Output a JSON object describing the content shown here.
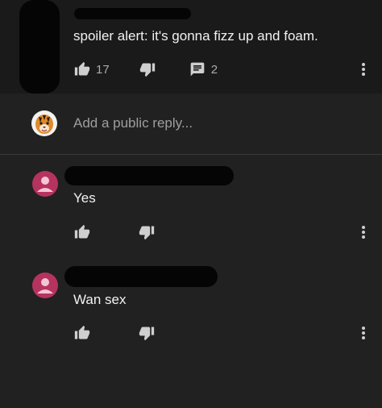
{
  "parent_comment": {
    "text": "spoiler alert: it's gonna fizz up and foam.",
    "like_count": "17",
    "reply_count": "2"
  },
  "reply_box": {
    "placeholder": "Add a public reply..."
  },
  "replies": [
    {
      "text": "Yes"
    },
    {
      "text": "Wan sex"
    }
  ],
  "icons": {
    "like": "thumb-up-icon",
    "dislike": "thumb-down-icon",
    "reply": "comment-icon",
    "more": "more-vert-icon",
    "avatar_default": "person-icon",
    "avatar_tiger": "tiger-avatar-icon"
  },
  "colors": {
    "background": "#212121",
    "parent_background": "#1a1a1a",
    "avatar_pink": "#b6335f",
    "icon": "#cfcfcf",
    "placeholder": "#9e9e9e"
  }
}
